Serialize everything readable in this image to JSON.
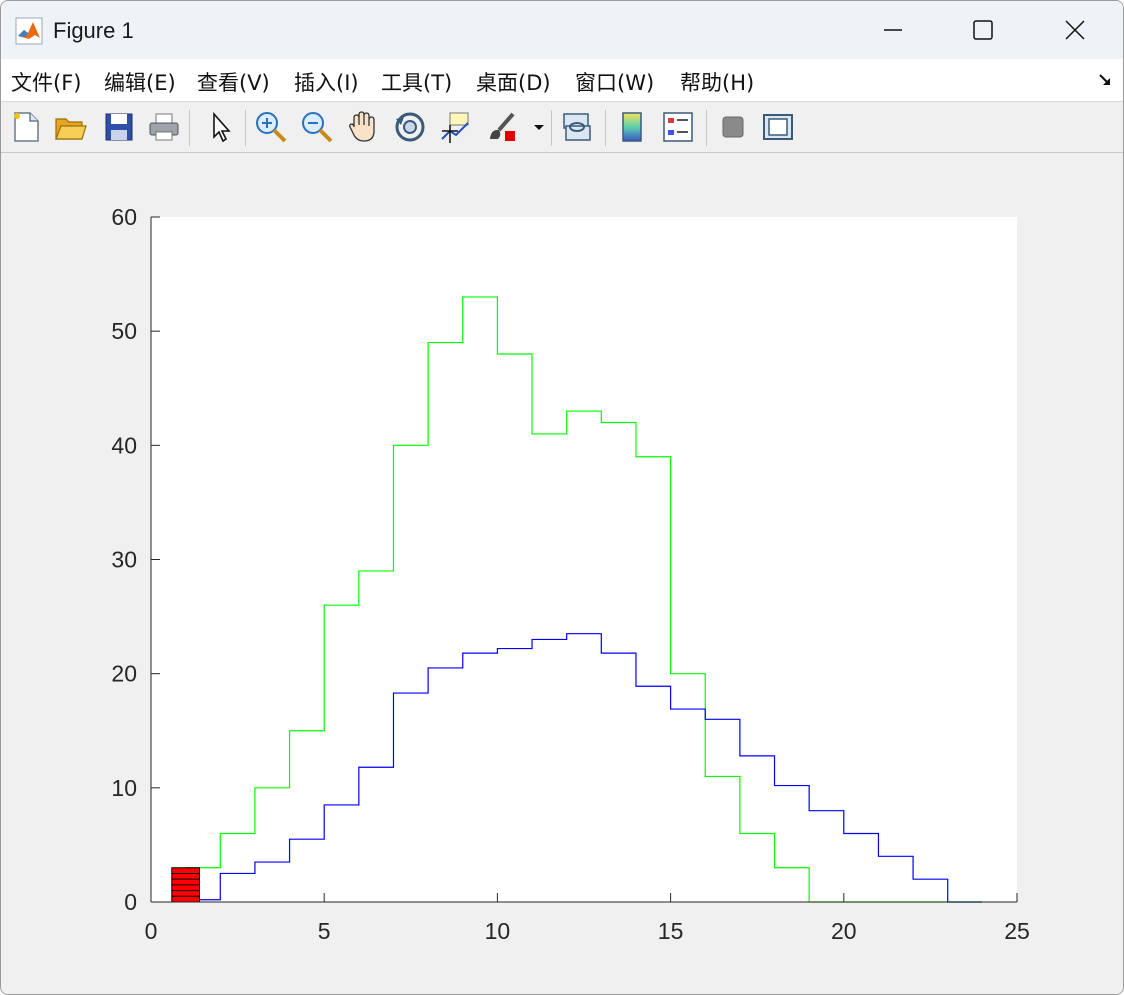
{
  "window": {
    "title": "Figure 1",
    "minimize_label": "—",
    "maximize_label": "☐",
    "close_label": "✕"
  },
  "menu": {
    "items": [
      {
        "label": "文件(F)"
      },
      {
        "label": "编辑(E)"
      },
      {
        "label": "查看(V)"
      },
      {
        "label": "插入(I)"
      },
      {
        "label": "工具(T)"
      },
      {
        "label": "桌面(D)"
      },
      {
        "label": "窗口(W)"
      },
      {
        "label": "帮助(H)"
      }
    ]
  },
  "toolbar": {
    "icons": [
      "new-figure-icon",
      "open-file-icon",
      "save-icon",
      "print-icon",
      "select-arrow-icon",
      "zoom-in-icon",
      "zoom-out-icon",
      "pan-hand-icon",
      "rotate-3d-icon",
      "data-cursor-icon",
      "brush-icon",
      "link-plot-icon",
      "colorbar-icon",
      "legend-icon",
      "hide-plot-tools-icon",
      "show-plot-tools-icon"
    ]
  },
  "colors": {
    "green_series": "#00ff00",
    "blue_series": "#0000ff",
    "red_bar": "#ff0000"
  },
  "chart_data": {
    "type": "line",
    "title": "",
    "xlabel": "",
    "ylabel": "",
    "xlim": [
      0,
      25
    ],
    "ylim": [
      0,
      60
    ],
    "xticks": [
      0,
      5,
      10,
      15,
      20,
      25
    ],
    "yticks": [
      0,
      10,
      20,
      30,
      40,
      50,
      60
    ],
    "grid": false,
    "style": "stairs",
    "series": [
      {
        "color": "#00ff00",
        "edges": [
          1,
          2,
          3,
          4,
          5,
          6,
          7,
          8,
          9,
          10,
          11,
          12,
          13,
          14,
          15,
          16,
          17,
          18,
          19,
          20,
          21,
          22,
          23,
          24
        ],
        "values": [
          3,
          6,
          10,
          15,
          26,
          29,
          40,
          49,
          53,
          48,
          41,
          43,
          42,
          39,
          20,
          11,
          6,
          3,
          0,
          0,
          0,
          0,
          0
        ]
      },
      {
        "color": "#0000ff",
        "edges": [
          1,
          2,
          3,
          4,
          5,
          6,
          7,
          8,
          9,
          10,
          11,
          12,
          13,
          14,
          15,
          16,
          17,
          18,
          19,
          20,
          21,
          22,
          23,
          24
        ],
        "values": [
          0.2,
          2.5,
          3.5,
          5.5,
          8.5,
          11.8,
          18.3,
          20.5,
          21.8,
          22.2,
          23,
          23.5,
          21.8,
          18.9,
          16.9,
          16,
          12.8,
          10.2,
          8,
          6,
          4,
          2,
          0
        ]
      }
    ],
    "bars": [
      {
        "x": 1,
        "width": 0.8,
        "value": 3,
        "color": "#ff0000",
        "stripes": [
          0.5,
          1,
          1.5,
          2,
          2.5
        ]
      }
    ]
  }
}
